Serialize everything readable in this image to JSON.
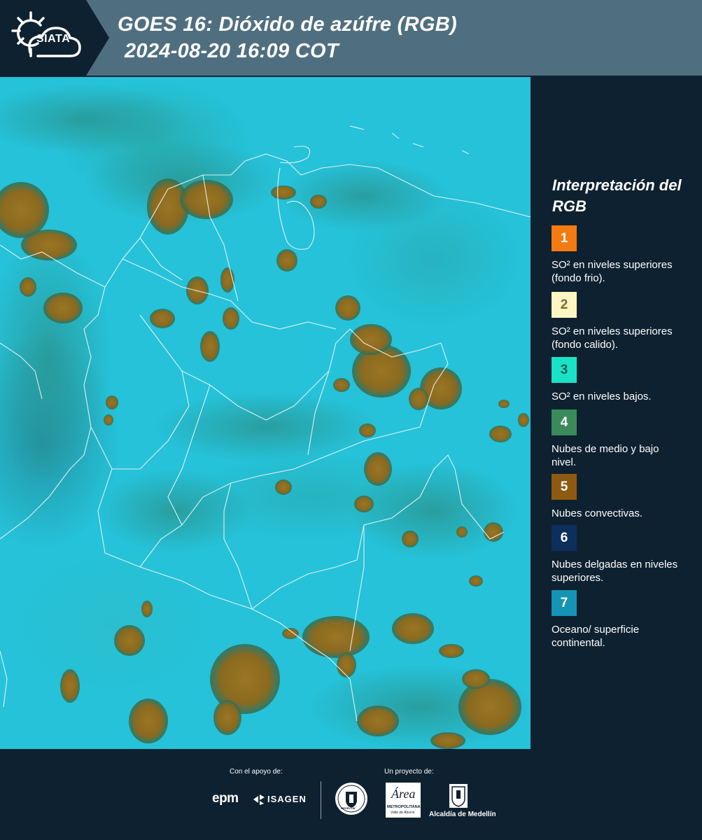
{
  "header": {
    "logo_text": "SIATA",
    "title_line1": "GOES 16: Dióxido de azúfre (RGB)",
    "title_line2": "2024-08-20 16:09 COT"
  },
  "map": {
    "icon": "satellite-map-image",
    "ocean_color": "#25c2d9",
    "cloud_color": "#8e6d22"
  },
  "legend": {
    "title": "Interpretación del RGB",
    "items": [
      {
        "number": "1",
        "label": "SO² en niveles superiores (fondo frio).",
        "color": "#f47a12",
        "text_color": "#ffffff"
      },
      {
        "number": "2",
        "label": "SO² en niveles superiores (fondo calido).",
        "color": "#fdf6c2",
        "text_color": "#7a6a30"
      },
      {
        "number": "3",
        "label": "SO² en niveles bajos.",
        "color": "#19e3c6",
        "text_color": "#0f5f55"
      },
      {
        "number": "4",
        "label": "Nubes de medio y bajo nivel.",
        "color": "#3a8a5c",
        "text_color": "#ffffff"
      },
      {
        "number": "5",
        "label": "Nubes convectivas.",
        "color": "#8e5a12",
        "text_color": "#ffffff"
      },
      {
        "number": "6",
        "label": "Nubes delgadas en niveles superiores.",
        "color": "#0d2f5c",
        "text_color": "#ffffff"
      },
      {
        "number": "7",
        "label": "Oceano/ superficie continental.",
        "color": "#1594b5",
        "text_color": "#ffffff"
      }
    ]
  },
  "footer": {
    "support_label": "Con el apoyo de:",
    "project_label": "Un proyecto de:",
    "epm": "epm",
    "isagen": "ISAGEN",
    "area_logo": "Área",
    "area_sub1": "METROPOLITANA",
    "area_sub2": "Valle de Aburrá",
    "alcaldia": "Alcaldía de Medellín",
    "seal_text": "MEDELLÍN"
  }
}
